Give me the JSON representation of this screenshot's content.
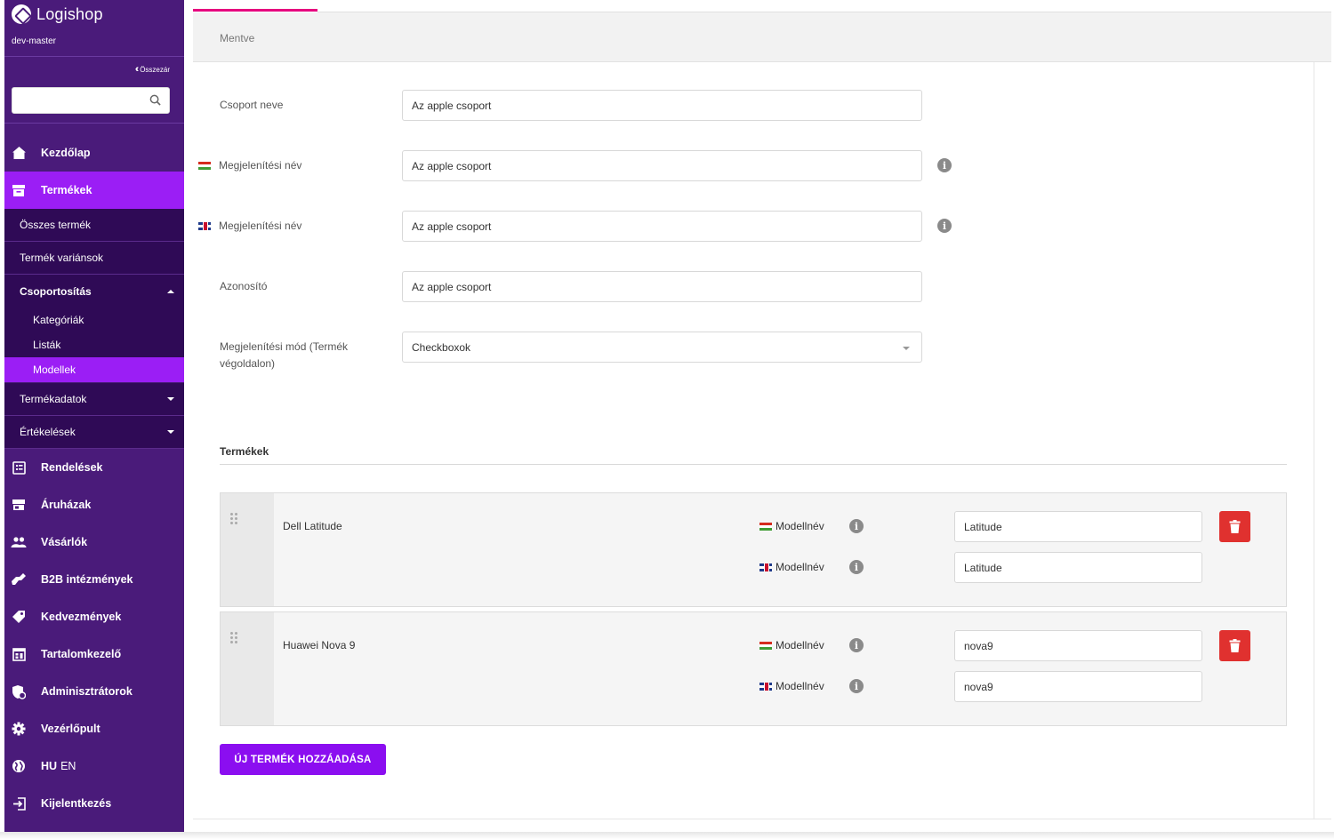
{
  "app": {
    "name": "Logishop",
    "environment": "dev-master",
    "collapse_label": "Összezár"
  },
  "search": {
    "placeholder": ""
  },
  "nav": {
    "home": "Kezdőlap",
    "products": "Termékek",
    "products_sub": {
      "all": "Összes termék",
      "variants": "Termék variánsok",
      "grouping": "Csoportosítás",
      "grouping_items": [
        "Kategóriák",
        "Listák",
        "Modellek"
      ],
      "product_data": "Termékadatok",
      "ratings": "Értékelések"
    },
    "orders": "Rendelések",
    "stores": "Áruházak",
    "customers": "Vásárlók",
    "b2b": "B2B intézmények",
    "discounts": "Kedvezmények",
    "cms": "Tartalomkezelő",
    "admins": "Adminisztrátorok",
    "dashboard": "Vezérlőpult",
    "lang_hu": "HU",
    "lang_en": "EN",
    "logout": "Kijelentkezés"
  },
  "status": {
    "saved": "Mentve"
  },
  "form": {
    "group_name_label": "Csoport neve",
    "group_name_value": "Az apple csoport",
    "display_name_label": "Megjelenítési név",
    "display_name_hu_value": "Az apple csoport",
    "display_name_en_value": "Az apple csoport",
    "identifier_label": "Azonosító",
    "identifier_value": "Az apple csoport",
    "display_mode_label": "Megjelenítési mód (Termék végoldalon)",
    "display_mode_value": "Checkboxok"
  },
  "products_section": {
    "title": "Termékek",
    "model_label": "Modellnév",
    "items": [
      {
        "name": "Dell Latitude",
        "model_hu": "Latitude",
        "model_en": "Latitude"
      },
      {
        "name": "Huawei Nova 9",
        "model_hu": "nova9",
        "model_en": "nova9"
      }
    ],
    "add_button": "ÚJ TERMÉK HOZZÁADÁSA"
  },
  "colors": {
    "sidebar": "#4a1b7a",
    "accent": "#9b1ef5",
    "submenu": "#2f0a56",
    "delete": "#e0312f",
    "tab_indicator": "#e6007e"
  }
}
